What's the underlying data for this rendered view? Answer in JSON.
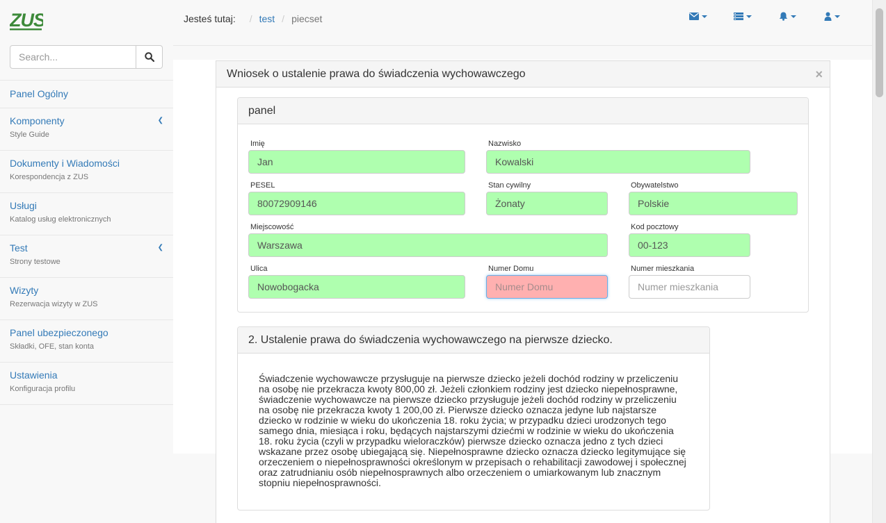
{
  "brand": {
    "logo_text": "ZUS",
    "color": "#3d8a3a"
  },
  "search": {
    "placeholder": "Search...",
    "icon": "search-icon"
  },
  "sidebar": {
    "items": [
      {
        "title": "Panel Ogólny",
        "subtitle": ""
      },
      {
        "title": "Komponenty",
        "subtitle": "Style Guide",
        "chevron": "chevron-left-icon"
      },
      {
        "title": "Dokumenty i Wiadomości",
        "subtitle": "Korespondencja z ZUS"
      },
      {
        "title": "Usługi",
        "subtitle": "Katalog usług elektronicznych"
      },
      {
        "title": "Test",
        "subtitle": "Strony testowe",
        "chevron": "chevron-left-icon"
      },
      {
        "title": "Wizyty",
        "subtitle": "Rezerwacja wizyty w ZUS"
      },
      {
        "title": "Panel ubezpieczonego",
        "subtitle": "Składki, OFE, stan konta"
      },
      {
        "title": "Ustawienia",
        "subtitle": "Konfiguracja profilu"
      }
    ]
  },
  "breadcrumb": {
    "label": "Jesteś tutaj:",
    "items": [
      "test",
      "piecset"
    ]
  },
  "topbar": {
    "icons": [
      "envelope-icon",
      "list-icon",
      "bell-icon",
      "user-icon"
    ]
  },
  "modal": {
    "title": "Wniosek o ustalenie prawa do świadczenia wychowawczego",
    "close": "×"
  },
  "panel1": {
    "title": "panel",
    "fields": {
      "imie": {
        "label": "Imię",
        "value": "Jan"
      },
      "nazwisko": {
        "label": "Nazwisko",
        "value": "Kowalski"
      },
      "pesel": {
        "label": "PESEL",
        "value": "80072909146"
      },
      "stan": {
        "label": "Stan cywilny",
        "value": "Żonaty"
      },
      "obywatelstwo": {
        "label": "Obywatelstwo",
        "value": "Polskie"
      },
      "miejscowosc": {
        "label": "Miejscowość",
        "value": "Warszawa"
      },
      "kod": {
        "label": "Kod pocztowy",
        "value": "00-123"
      },
      "ulica": {
        "label": "Ulica",
        "value": "Nowobogacka"
      },
      "dom": {
        "label": "Numer Domu",
        "placeholder": "Numer Domu"
      },
      "mieszkanie": {
        "label": "Numer mieszkania",
        "placeholder": "Numer mieszkania"
      }
    }
  },
  "panel2": {
    "title": "2. Ustalenie prawa do świadczenia wychowawczego na pierwsze dziecko.",
    "body": "Świadczenie wychowawcze przysługuje na pierwsze dziecko jeżeli dochód rodziny w przeliczeniu na osobę nie przekracza kwoty 800,00 zł. Jeżeli członkiem rodziny jest dziecko niepełnosprawne, świadczenie wychowawcze na pierwsze dziecko przysługuje jeżeli dochód rodziny w przeliczeniu na osobę nie przekracza kwoty 1 200,00 zł. Pierwsze dziecko oznacza jedyne lub najstarsze dziecko w rodzinie w wieku do ukończenia 18. roku życia; w przypadku dzieci urodzonych tego samego dnia, miesiąca i roku, będących najstarszymi dziećmi w rodzinie w wieku do ukończenia 18. roku życia (czyli w przypadku wieloraczków) pierwsze dziecko oznacza jedno z tych dzieci wskazane przez osobę ubiegającą się. Niepełnosprawne dziecko oznacza dziecko legitymujące się orzeczeniem o niepełnosprawności określonym w przepisach o rehabilitacji zawodowej i społecznej oraz zatrudnianiu osób niepełnosprawnych albo orzeczeniem o umiarkowanym lub znacznym stopniu niepełnosprawności."
  },
  "colors": {
    "link": "#337ab7",
    "valid_bg": "#afffaf",
    "invalid_bg": "#ffb0b0"
  }
}
